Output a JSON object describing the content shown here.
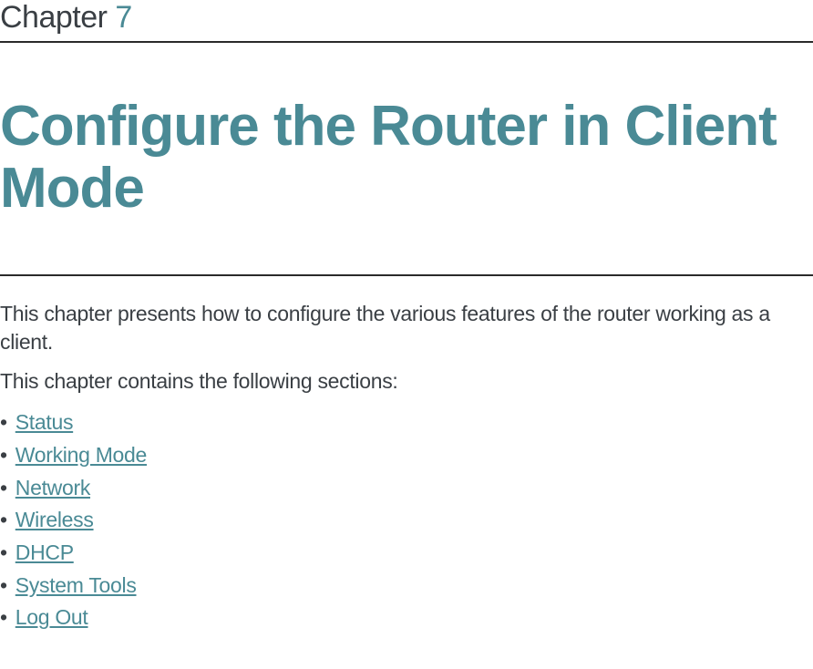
{
  "chapter": {
    "label": "Chapter",
    "number": "7"
  },
  "title": "Configure the Router in Client Mode",
  "intro": "This chapter presents how to configure the various features of the router working as a client.",
  "sections_intro": "This chapter contains the following sections:",
  "sections": [
    {
      "label": "Status"
    },
    {
      "label": "Working Mode"
    },
    {
      "label": "Network"
    },
    {
      "label": "Wireless"
    },
    {
      "label": "DHCP"
    },
    {
      "label": "System Tools"
    },
    {
      "label": "Log Out"
    }
  ]
}
